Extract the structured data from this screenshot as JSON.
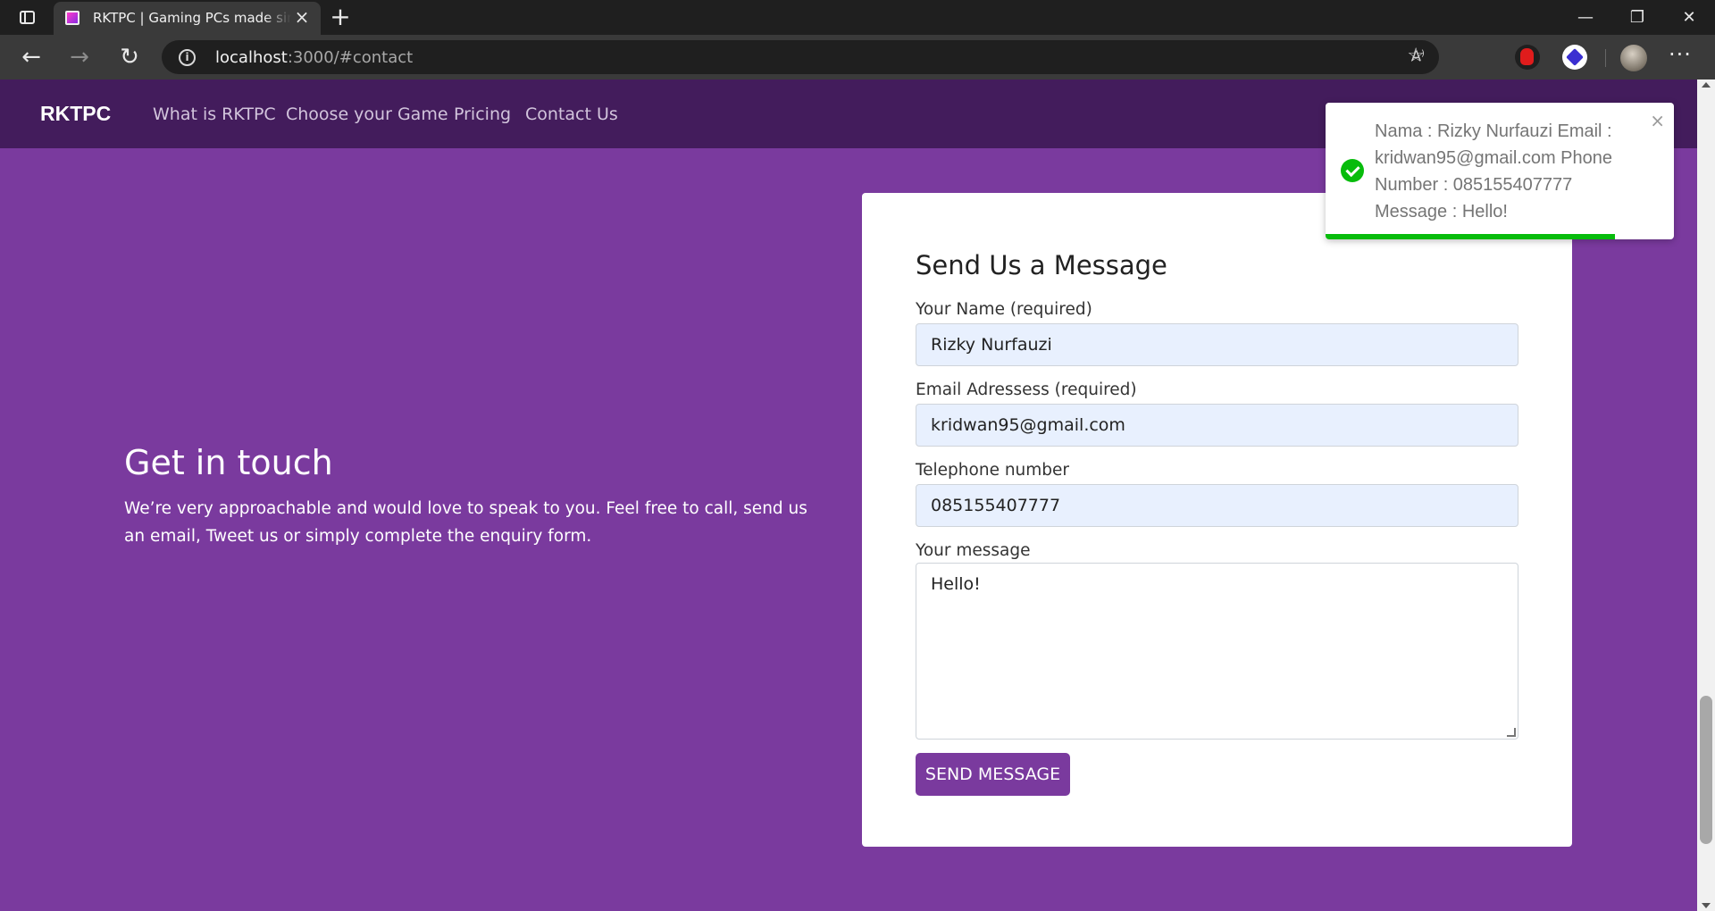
{
  "browser": {
    "tab_title": "RKTPC | Gaming PCs made simple",
    "new_tab": "+",
    "close_tab": "×",
    "url_host": "localhost",
    "url_rest": ":3000/#contact",
    "window_controls": {
      "minimize": "—",
      "restore": "❐",
      "close": "✕"
    },
    "nav": {
      "back": "←",
      "forward": "→",
      "reload": "↻"
    },
    "read_aloud": "A⁾",
    "favorites": "☆",
    "more": "···"
  },
  "site": {
    "brand": "RKTPC",
    "nav_links": [
      "What is RKTPC",
      "Choose your Game",
      "Pricing",
      "Contact Us"
    ],
    "accent_color": "#7a3a9e",
    "nav_color": "#431c5c"
  },
  "intro": {
    "heading": "Get in touch",
    "body": "We’re very approachable and would love to speak to you. Feel free to call, send us an email, Tweet us or simply complete the enquiry form."
  },
  "form": {
    "heading": "Send Us a Message",
    "name_label": "Your Name (required)",
    "name_value": "Rizky Nurfauzi",
    "email_label": "Email Adressess (required)",
    "email_value": "kridwan95@gmail.com",
    "phone_label": "Telephone number",
    "phone_value": "085155407777",
    "message_label": "Your message",
    "message_value": "Hello!",
    "submit_label": "SEND MESSAGE"
  },
  "toast": {
    "message": "Nama : Rizky Nurfauzi Email : kridwan95@gmail.com Phone Number : 085155407777 Message : Hello!",
    "close": "×",
    "status_color": "#07bc0c",
    "progress": 0.83
  }
}
